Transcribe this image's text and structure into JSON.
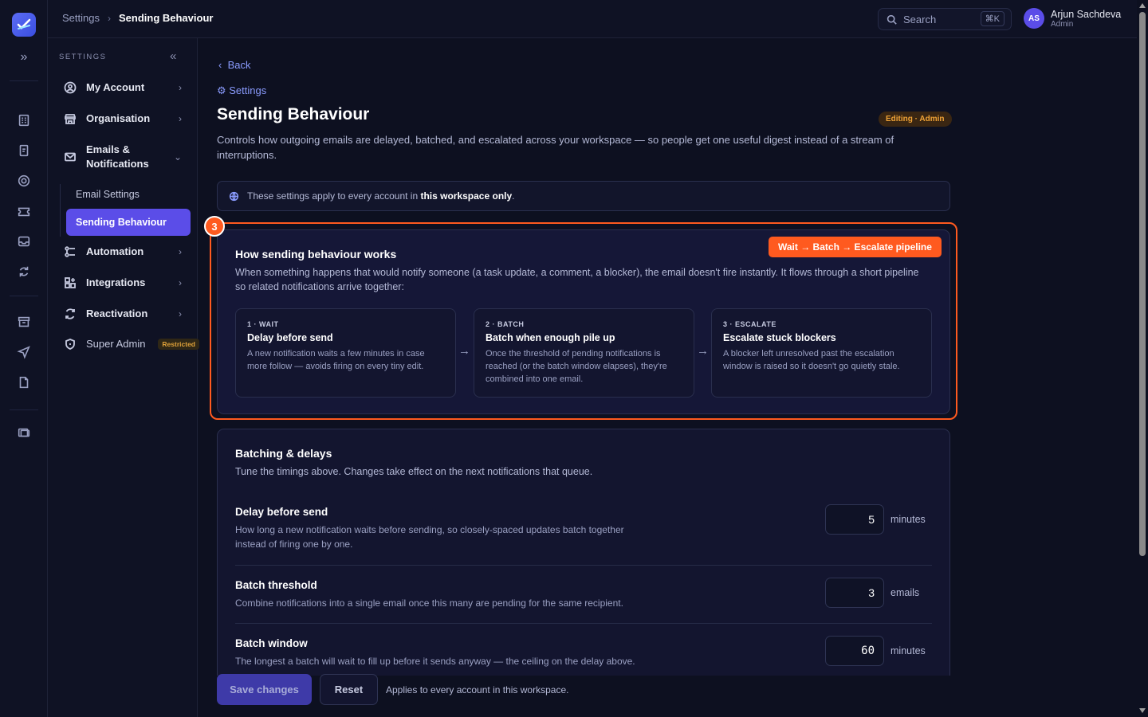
{
  "topbar": {
    "breadcrumb_parent": "Settings",
    "breadcrumb_current": "Sending Behaviour",
    "search_placeholder": "Search",
    "search_shortcut": "⌘K",
    "user_initials": "AS",
    "user_name": "Arjun Sachdeva",
    "user_role": "Admin"
  },
  "sidebar": {
    "header": "SETTINGS",
    "items": [
      {
        "label": "My Account"
      },
      {
        "label": "Organisation"
      },
      {
        "label": "Emails & Notifications"
      },
      {
        "label": "Automation"
      },
      {
        "label": "Integrations"
      },
      {
        "label": "Reactivation"
      },
      {
        "label": "Super Admin",
        "badge": "Restricted"
      }
    ],
    "subitems": [
      {
        "label": "Email Settings"
      },
      {
        "label": "Sending Behaviour"
      }
    ]
  },
  "page": {
    "back_label": "Back",
    "settings_link": "⚙ Settings",
    "title": "Sending Behaviour",
    "badge": "Editing · Admin",
    "description": "Controls how outgoing emails are delayed, batched, and escalated across your workspace — so people get one useful digest instead of a stream of interruptions.",
    "info_prefix": "These settings apply to every account in ",
    "info_bold": "this workspace only",
    "info_suffix": "."
  },
  "how_card": {
    "step_marker": "3",
    "title": "How sending behaviour works",
    "pill": "Wait → Batch → Escalate pipeline",
    "description": "When something happens that would notify someone (a task update, a comment, a blocker), the email doesn't fire instantly. It flows through a short pipeline so related notifications arrive together:",
    "steps": [
      {
        "kicker": "1 · WAIT",
        "title": "Delay before send",
        "desc": "A new notification waits a few minutes in case more follow — avoids firing on every tiny edit."
      },
      {
        "kicker": "2 · BATCH",
        "title": "Batch when enough pile up",
        "desc": "Once the threshold of pending notifications is reached (or the batch window elapses), they're combined into one email."
      },
      {
        "kicker": "3 · ESCALATE",
        "title": "Escalate stuck blockers",
        "desc": "A blocker left unresolved past the escalation window is raised so it doesn't go quietly stale."
      }
    ],
    "arrow": "→"
  },
  "batch_card": {
    "title": "Batching & delays",
    "description": "Tune the timings above. Changes take effect on the next notifications that queue.",
    "rows": [
      {
        "title": "Delay before send",
        "desc": "How long a new notification waits before sending, so closely-spaced updates batch together instead of firing one by one.",
        "value": "5",
        "unit": "minutes"
      },
      {
        "title": "Batch threshold",
        "desc": "Combine notifications into a single email once this many are pending for the same recipient.",
        "value": "3",
        "unit": "emails"
      },
      {
        "title": "Batch window",
        "desc": "The longest a batch will wait to fill up before it sends anyway — the ceiling on the delay above.",
        "value": "60",
        "unit": "minutes"
      }
    ]
  },
  "footer": {
    "save_label": "Save changes",
    "reset_label": "Reset",
    "note": "Applies to every account in this workspace."
  },
  "colors": {
    "accent": "#5b4de8",
    "highlight": "#ff5a1f",
    "link": "#8b9cff",
    "badge_text": "#f0a336"
  }
}
